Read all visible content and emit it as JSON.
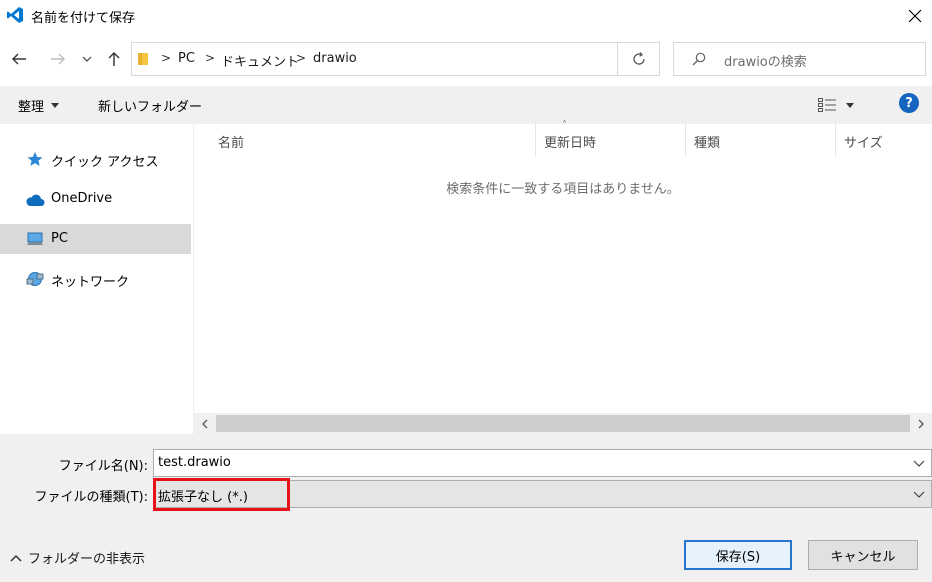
{
  "window": {
    "title": "名前を付けて保存"
  },
  "breadcrumb": {
    "items": [
      "PC",
      "ドキュメント",
      "drawio"
    ]
  },
  "search": {
    "placeholder": "drawioの検索"
  },
  "toolbar": {
    "organize_label": "整理",
    "new_folder_label": "新しいフォルダー"
  },
  "sidebar": {
    "items": [
      {
        "label": "クイック アクセス",
        "icon": "star-icon"
      },
      {
        "label": "OneDrive",
        "icon": "cloud-icon"
      },
      {
        "label": "PC",
        "icon": "computer-icon",
        "selected": true
      },
      {
        "label": "ネットワーク",
        "icon": "network-icon"
      }
    ]
  },
  "filelist": {
    "columns": [
      "名前",
      "更新日時",
      "種類",
      "サイズ"
    ],
    "empty_message": "検索条件に一致する項目はありません。"
  },
  "form": {
    "filename_label": "ファイル名(N):",
    "filename_value": "test.drawio",
    "filetype_label": "ファイルの種類(T):",
    "filetype_value": "拡張子なし (*.)"
  },
  "footer": {
    "hide_folders_label": "フォルダーの非表示",
    "save_label": "保存(S)",
    "cancel_label": "キャンセル"
  },
  "colors": {
    "accent": "#2774d0",
    "highlight": "#e8131a",
    "vscode_blue": "#0078d4"
  }
}
